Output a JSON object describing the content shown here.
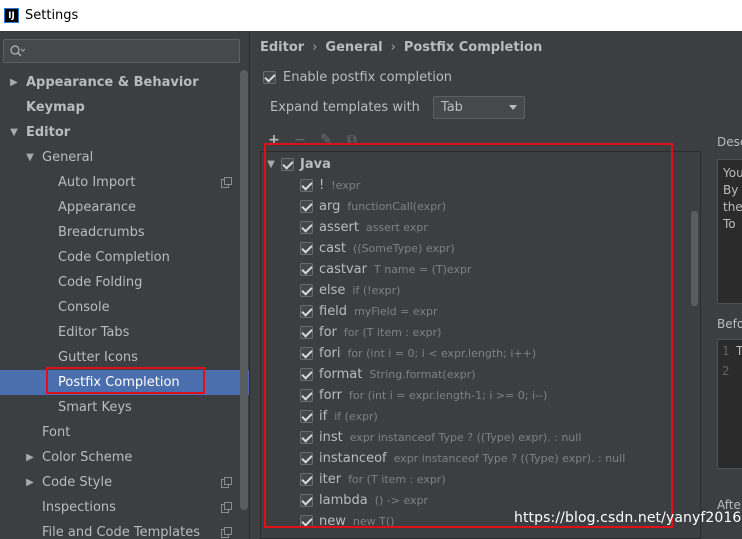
{
  "window": {
    "title": "Settings",
    "app_icon_text": "IJ"
  },
  "sidebar": {
    "search": {
      "icon": "search-icon"
    },
    "items": [
      {
        "label": "Appearance & Behavior",
        "level": 0,
        "arrow": "▶",
        "bold": true
      },
      {
        "label": "Keymap",
        "level": 0,
        "arrow": "",
        "bold": true
      },
      {
        "label": "Editor",
        "level": 0,
        "arrow": "▼",
        "bold": true
      },
      {
        "label": "General",
        "level": 1,
        "arrow": "▼"
      },
      {
        "label": "Auto Import",
        "level": 2,
        "arrow": "",
        "copy": true
      },
      {
        "label": "Appearance",
        "level": 2,
        "arrow": ""
      },
      {
        "label": "Breadcrumbs",
        "level": 2,
        "arrow": ""
      },
      {
        "label": "Code Completion",
        "level": 2,
        "arrow": ""
      },
      {
        "label": "Code Folding",
        "level": 2,
        "arrow": ""
      },
      {
        "label": "Console",
        "level": 2,
        "arrow": ""
      },
      {
        "label": "Editor Tabs",
        "level": 2,
        "arrow": ""
      },
      {
        "label": "Gutter Icons",
        "level": 2,
        "arrow": ""
      },
      {
        "label": "Postfix Completion",
        "level": 2,
        "arrow": "",
        "selected": true
      },
      {
        "label": "Smart Keys",
        "level": 2,
        "arrow": ""
      },
      {
        "label": "Font",
        "level": 1,
        "arrow": ""
      },
      {
        "label": "Color Scheme",
        "level": 1,
        "arrow": "▶"
      },
      {
        "label": "Code Style",
        "level": 1,
        "arrow": "▶",
        "copy": true
      },
      {
        "label": "Inspections",
        "level": 1,
        "arrow": "",
        "copy": true
      },
      {
        "label": "File and Code Templates",
        "level": 1,
        "arrow": "",
        "copy": true
      }
    ]
  },
  "breadcrumb": [
    "Editor",
    "General",
    "Postfix Completion"
  ],
  "enable": {
    "label": "Enable postfix completion",
    "checked": true
  },
  "expand": {
    "label": "Expand templates with",
    "value": "Tab"
  },
  "toolbar": {
    "add": "+",
    "remove": "−",
    "edit": "✎",
    "copy": "⧉"
  },
  "templates": {
    "group": "Java",
    "items": [
      {
        "key": "!",
        "desc": "!expr"
      },
      {
        "key": "arg",
        "desc": "functionCall(expr)"
      },
      {
        "key": "assert",
        "desc": "assert expr"
      },
      {
        "key": "cast",
        "desc": "((SomeType) expr)"
      },
      {
        "key": "castvar",
        "desc": "T name = (T)expr"
      },
      {
        "key": "else",
        "desc": "if (!expr)"
      },
      {
        "key": "field",
        "desc": "myField = expr"
      },
      {
        "key": "for",
        "desc": "for (T item : expr)"
      },
      {
        "key": "fori",
        "desc": "for (int i = 0; i < expr.length; i++)"
      },
      {
        "key": "format",
        "desc": "String.format(expr)"
      },
      {
        "key": "forr",
        "desc": "for (int i = expr.length-1; i >= 0; i--)"
      },
      {
        "key": "if",
        "desc": "if (expr)"
      },
      {
        "key": "inst",
        "desc": "expr instanceof Type ? ((Type) expr). : null"
      },
      {
        "key": "instanceof",
        "desc": "expr instanceof Type ? ((Type) expr). : null"
      },
      {
        "key": "iter",
        "desc": "for (T item : expr)"
      },
      {
        "key": "lambda",
        "desc": "() -> expr"
      },
      {
        "key": "new",
        "desc": "new T()"
      }
    ]
  },
  "description": {
    "title": "Desc",
    "lines": [
      "You",
      "By",
      "the",
      "To"
    ]
  },
  "before": {
    "title": "Befo",
    "lines": [
      {
        "num": "1",
        "code": "T"
      },
      {
        "num": "2",
        "code": ""
      }
    ]
  },
  "after": {
    "title": "After"
  },
  "watermark": "https://blog.csdn.net/yanyf2016",
  "colors": {
    "selection": "#4b6eaf",
    "highlight": "#e0101a",
    "background": "#3c3f41"
  }
}
